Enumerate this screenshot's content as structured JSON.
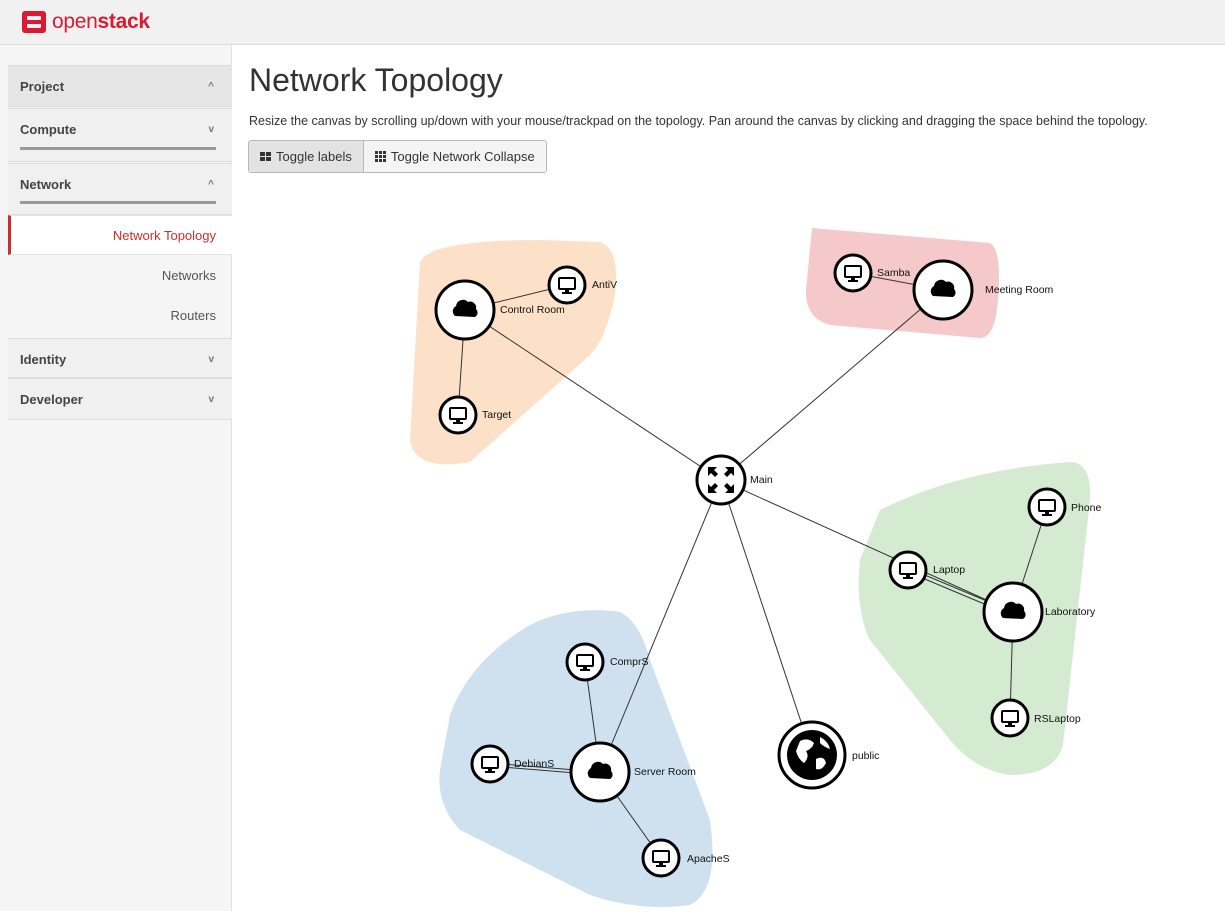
{
  "brand": {
    "open": "open",
    "stack": "stack"
  },
  "sidebar": {
    "project": {
      "label": "Project",
      "chevron": "^"
    },
    "compute": {
      "label": "Compute",
      "chevron": "v"
    },
    "network": {
      "label": "Network",
      "chevron": "^"
    },
    "network_items": [
      {
        "label": "Network Topology",
        "active": true
      },
      {
        "label": "Networks",
        "active": false
      },
      {
        "label": "Routers",
        "active": false
      }
    ],
    "identity": {
      "label": "Identity",
      "chevron": "v"
    },
    "developer": {
      "label": "Developer",
      "chevron": "v"
    }
  },
  "main": {
    "title": "Network Topology",
    "description": "Resize the canvas by scrolling up/down with your mouse/trackpad on the topology. Pan around the canvas by clicking and dragging the space behind the topology.",
    "toggle_labels": "Toggle labels",
    "toggle_collapse": "Toggle Network Collapse"
  },
  "topology": {
    "colors": {
      "control_room": "#fde0c8",
      "meeting_room": "#f5c9c9",
      "laboratory": "#d4ebd2",
      "server_room": "#cfe1ef"
    },
    "nodes": {
      "main": "Main",
      "public": "public",
      "control_room": "Control Room",
      "antiv": "AntiV",
      "target": "Target",
      "meeting_room": "Meeting Room",
      "samba": "Samba",
      "laboratory": "Laboratory",
      "phone": "Phone",
      "laptop": "Laptop",
      "rslaptop": "RSLaptop",
      "server_room": "Server Room",
      "comprs": "ComprS",
      "debians": "DebianS",
      "apaches": "ApacheS"
    }
  }
}
